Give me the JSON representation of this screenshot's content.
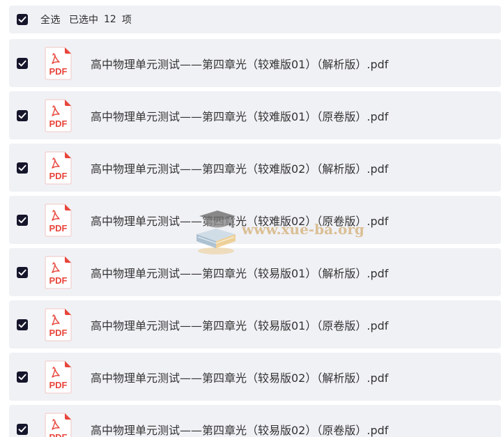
{
  "selection_bar": {
    "select_all_label": "全选",
    "selected_prefix": "已选中",
    "selected_count": "12",
    "selected_suffix": "项"
  },
  "files": [
    {
      "name": "高中物理单元测试——第四章光（较难版01）（解析版）.pdf",
      "type_label": "PDF",
      "checked": true
    },
    {
      "name": "高中物理单元测试——第四章光（较难版01）（原卷版）.pdf",
      "type_label": "PDF",
      "checked": true
    },
    {
      "name": "高中物理单元测试——第四章光（较难版02）（解析版）.pdf",
      "type_label": "PDF",
      "checked": true
    },
    {
      "name": "高中物理单元测试——第四章光（较难版02）（原卷版）.pdf",
      "type_label": "PDF",
      "checked": true
    },
    {
      "name": "高中物理单元测试——第四章光（较易版01）（解析版）.pdf",
      "type_label": "PDF",
      "checked": true
    },
    {
      "name": "高中物理单元测试——第四章光（较易版01）（原卷版）.pdf",
      "type_label": "PDF",
      "checked": true
    },
    {
      "name": "高中物理单元测试——第四章光（较易版02）（解析版）.pdf",
      "type_label": "PDF",
      "checked": true
    },
    {
      "name": "高中物理单元测试——第四章光（较易版02）（原卷版）.pdf",
      "type_label": "PDF",
      "checked": true
    }
  ],
  "watermark": {
    "text": "www.xue-ba.org",
    "icon": "graduation-cap-book-icon"
  },
  "colors": {
    "row_background": "#f0f1f5",
    "checkbox_fill": "#15162b",
    "pdf_red": "#e8463c",
    "text": "#333333"
  }
}
